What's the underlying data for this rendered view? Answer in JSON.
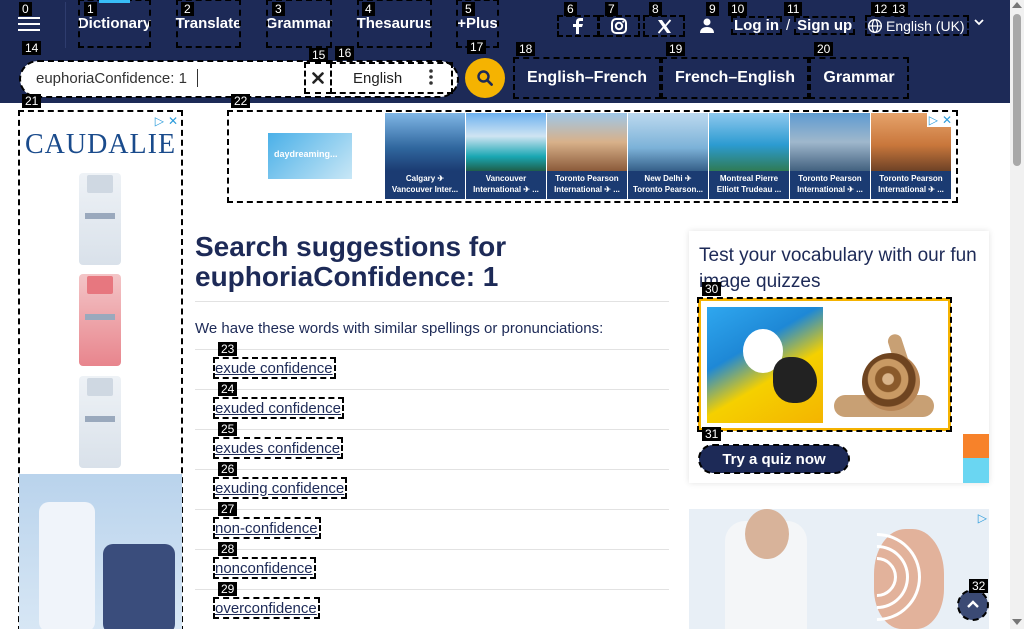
{
  "header": {
    "nav": [
      {
        "label": "Dictionary",
        "active": true
      },
      {
        "label": "Translate"
      },
      {
        "label": "Grammar"
      },
      {
        "label": "Thesaurus"
      },
      {
        "label": "+Plus"
      }
    ],
    "social": [
      "facebook-icon",
      "instagram-icon",
      "x-icon"
    ],
    "login": "Log in",
    "slash": "/",
    "signup": "Sign up",
    "language": "English (UK)"
  },
  "search": {
    "value": "euphoriaConfidence: 1",
    "dictionary_select": "English",
    "dict_links": [
      "English–French",
      "French–English",
      "Grammar"
    ]
  },
  "ads": {
    "brand": "CAUDALIE",
    "promo_text": "daydreaming...",
    "flights": [
      {
        "line1": "Calgary ✈",
        "line2": "Vancouver Inter..."
      },
      {
        "line1": "Vancouver",
        "line2": "International ✈ ..."
      },
      {
        "line1": "Toronto Pearson",
        "line2": "International ✈ ..."
      },
      {
        "line1": "New Delhi ✈",
        "line2": "Toronto Pearson..."
      },
      {
        "line1": "Montreal Pierre",
        "line2": "Elliott Trudeau ..."
      },
      {
        "line1": "Toronto Pearson",
        "line2": "International ✈ ..."
      },
      {
        "line1": "Toronto Pearson",
        "line2": "International ✈ ..."
      }
    ]
  },
  "main": {
    "heading_prefix": "Search suggestions for",
    "heading_term": "euphoriaConfidence: 1",
    "intro": "We have these words with similar spellings or pronunciations:",
    "suggestions": [
      "exude confidence",
      "exuded confidence",
      "exudes confidence",
      "exuding confidence",
      "non-confidence",
      "nonconfidence",
      "overconfidence"
    ]
  },
  "quiz": {
    "title": "Test your vocabulary with our fun image quizzes",
    "button": "Try a quiz now"
  },
  "colors": {
    "header_bg": "#1d2a57",
    "accent": "#f5b301",
    "link": "#1d2a57"
  }
}
